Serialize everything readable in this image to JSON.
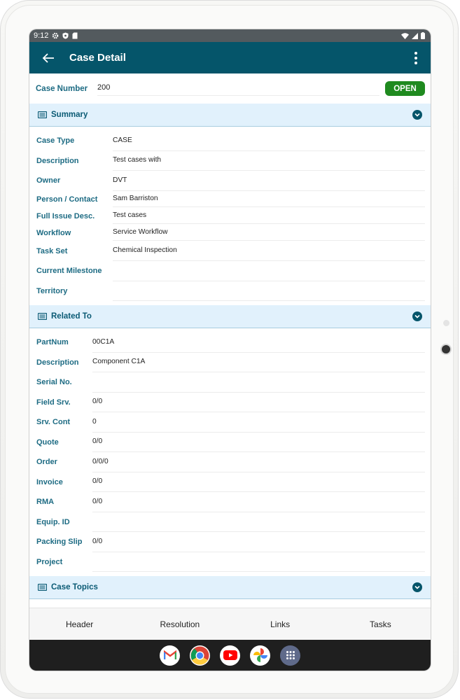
{
  "status_bar": {
    "time": "9:12",
    "icons": [
      "gear-icon",
      "shield-icon",
      "sim-icon",
      "wifi-icon",
      "signal-icon",
      "battery-icon"
    ]
  },
  "app_bar": {
    "title": "Case Detail",
    "back_icon": "arrow-left-icon",
    "menu_icon": "kebab-menu-icon"
  },
  "case": {
    "number_label": "Case Number",
    "number_value": "200",
    "status": "OPEN",
    "status_color": "#1f8a1f"
  },
  "summary": {
    "title": "Summary",
    "fields": [
      {
        "label": "Case Type",
        "value": "CASE"
      },
      {
        "label": "Description",
        "value": "Test cases with"
      },
      {
        "label": "Owner",
        "value": "DVT"
      },
      {
        "label": "Person / Contact",
        "value": "Sam Barriston"
      },
      {
        "label": "Full Issue Desc.",
        "value": "Test cases"
      },
      {
        "label": "Workflow",
        "value": "Service Workflow"
      },
      {
        "label": "Task Set",
        "value": "Chemical Inspection"
      },
      {
        "label": "Current Milestone",
        "value": ""
      },
      {
        "label": "Territory",
        "value": ""
      }
    ]
  },
  "related": {
    "title": "Related To",
    "fields": [
      {
        "label": "PartNum",
        "value": "00C1A"
      },
      {
        "label": "Description",
        "value": "Component C1A"
      },
      {
        "label": "Serial No.",
        "value": ""
      },
      {
        "label": "Field Srv.",
        "value": "0/0"
      },
      {
        "label": "Srv. Cont",
        "value": "0"
      },
      {
        "label": "Quote",
        "value": "0/0"
      },
      {
        "label": "Order",
        "value": "0/0/0"
      },
      {
        "label": "Invoice",
        "value": "0/0"
      },
      {
        "label": "RMA",
        "value": "0/0"
      },
      {
        "label": "Equip. ID",
        "value": ""
      },
      {
        "label": "Packing Slip",
        "value": "0/0"
      },
      {
        "label": "Project",
        "value": ""
      }
    ]
  },
  "topics": {
    "title": "Case Topics"
  },
  "tabs": [
    "Header",
    "Resolution",
    "Links",
    "Tasks"
  ],
  "dock": [
    "gmail-icon",
    "chrome-icon",
    "youtube-icon",
    "photos-icon",
    "app-drawer-icon"
  ],
  "colors": {
    "app_bar": "#05556a",
    "label": "#1d6b83",
    "section_bg": "#e1f1fc"
  }
}
